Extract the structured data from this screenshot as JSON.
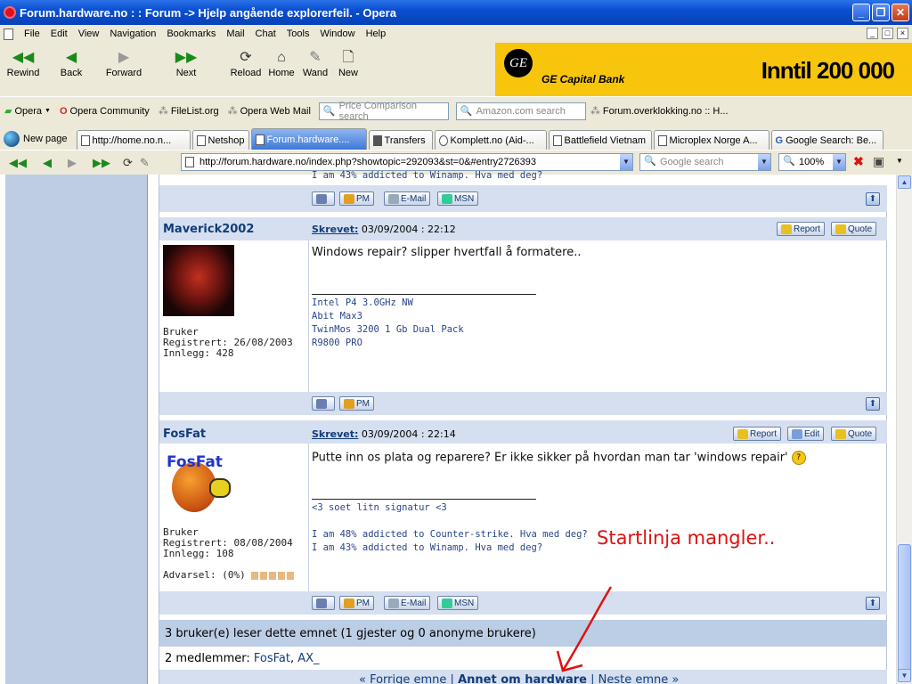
{
  "window": {
    "title": "Forum.hardware.no : : Forum -> Hjelp angående explorerfeil. - Opera",
    "minimize": "_",
    "maximize": "❐",
    "close": "✕"
  },
  "menu": [
    "File",
    "Edit",
    "View",
    "Navigation",
    "Bookmarks",
    "Mail",
    "Chat",
    "Tools",
    "Window",
    "Help"
  ],
  "mdi_controls": [
    "_",
    "□",
    "×"
  ],
  "nav": {
    "rewind": "Rewind",
    "back": "Back",
    "forward": "Forward",
    "next": "Next",
    "reload": "Reload",
    "home": "Home",
    "wand": "Wand",
    "new": "New"
  },
  "banner": {
    "logo": "GE",
    "brand": "GE Capital Bank",
    "text": "Inntil 200 000",
    "color": "#f7c50c"
  },
  "personal_bar": {
    "items": [
      "Opera",
      "Opera Community",
      "FileList.org",
      "Opera Web Mail"
    ],
    "price_search": "Price Comparison search",
    "amazon_search": "Amazon.com search",
    "overklokking": "Forum.overklokking.no :: H..."
  },
  "tabs": {
    "new_page": "New page",
    "items": [
      "http://home.no.n...",
      "Netshop",
      "Forum.hardware....",
      "Transfers",
      "Komplett.no (Aid-...",
      "Battlefield Vietnam",
      "Microplex Norge A...",
      "Google Search: Be..."
    ],
    "active_index": 2
  },
  "address": {
    "url": "http://forum.hardware.no/index.php?showtopic=292093&st=0&#entry2726393",
    "search_placeholder": "Google search",
    "zoom": "100%"
  },
  "forum": {
    "top_partial_sig": "I am 43% addicted to Winamp. Hva med deg?",
    "buttons": {
      "pm": "PM",
      "email": "E-Mail",
      "msn": "MSN",
      "report": "Report",
      "quote": "Quote",
      "edit": "Edit"
    },
    "posts": [
      {
        "username": "Maverick2002",
        "skrevet_label": "Skrevet:",
        "date": "03/09/2004 : 22:12",
        "rank": "Bruker",
        "registered": "Registrert: 26/08/2003",
        "posts": "Innlegg: 428",
        "text": "Windows repair? slipper hvertfall å formatere..",
        "signature": [
          "Intel P4 3.0GHz NW",
          "Abit Max3",
          "TwinMos 3200 1 Gb Dual Pack",
          "R9800 PRO"
        ]
      },
      {
        "username": "FosFat",
        "skrevet_label": "Skrevet:",
        "date": "03/09/2004 : 22:14",
        "rank": "Bruker",
        "registered": "Registrert: 08/08/2004",
        "posts": "Innlegg: 108",
        "warning": "Advarsel: (0%)",
        "avatar_text": "FosFat",
        "text": "Putte inn os plata og reparere? Er ikke sikker på hvordan man tar 'windows repair'",
        "signature": [
          "<3 soet litn signatur <3",
          "",
          "I am 48% addicted to Counter-strike. Hva med deg?",
          "I am 43% addicted to Winamp. Hva med deg?"
        ]
      }
    ],
    "readers": "3 bruker(e) leser dette emnet (1 gjester og 0 anonyme brukere)",
    "members_label": "2 medlemmer:",
    "members": [
      "FosFat",
      "AX_"
    ],
    "bottom_nav": {
      "prev": "« Forrige emne",
      "category": "Annet om hardware",
      "next": "Neste emne »"
    }
  },
  "annotation": {
    "text": "Startlinja mangler..",
    "color": "#e01010"
  }
}
